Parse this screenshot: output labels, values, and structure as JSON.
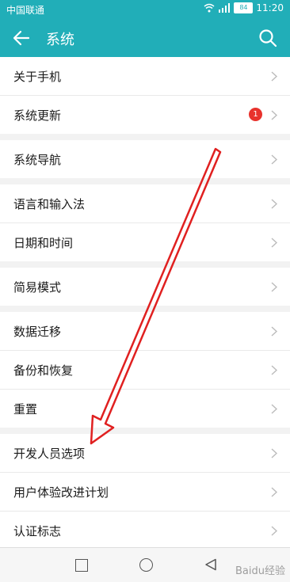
{
  "status_bar": {
    "carrier": "中国联通",
    "battery": "84",
    "time": "11:20"
  },
  "app_bar": {
    "title": "系统",
    "back_icon": "back-arrow-icon",
    "search_icon": "search-icon"
  },
  "groups": [
    {
      "items": [
        {
          "label": "关于手机"
        },
        {
          "label": "系统更新",
          "badge": "1"
        }
      ]
    },
    {
      "items": [
        {
          "label": "系统导航"
        }
      ]
    },
    {
      "items": [
        {
          "label": "语言和输入法"
        },
        {
          "label": "日期和时间"
        }
      ]
    },
    {
      "items": [
        {
          "label": "简易模式"
        }
      ]
    },
    {
      "items": [
        {
          "label": "数据迁移"
        },
        {
          "label": "备份和恢复"
        },
        {
          "label": "重置"
        }
      ]
    },
    {
      "items": [
        {
          "label": "开发人员选项"
        },
        {
          "label": "用户体验改进计划"
        },
        {
          "label": "认证标志"
        }
      ]
    }
  ],
  "watermark": "Baidu经验",
  "colors": {
    "accent": "#21aeb8",
    "badge": "#e8322c",
    "annotation_arrow": "#e02020"
  }
}
